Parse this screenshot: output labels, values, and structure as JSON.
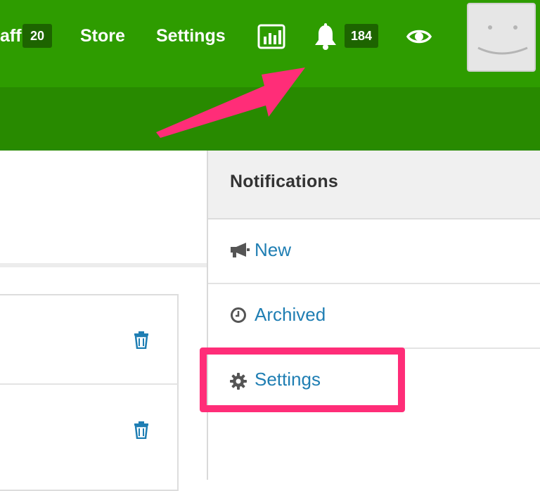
{
  "nav": {
    "staff_label": "aff",
    "staff_count": "20",
    "store_label": "Store",
    "settings_label": "Settings",
    "notifications_count": "184"
  },
  "panel": {
    "title": "Notifications",
    "items": [
      {
        "label": "New",
        "icon": "megaphone-icon"
      },
      {
        "label": "Archived",
        "icon": "clock-icon"
      },
      {
        "label": "Settings",
        "icon": "gear-icon"
      }
    ]
  },
  "colors": {
    "nav_green": "#2e9c00",
    "subbar_green": "#288a00",
    "badge_green": "#1d6400",
    "link_blue": "#1f7eb3",
    "highlight_pink": "#ff2d78"
  }
}
